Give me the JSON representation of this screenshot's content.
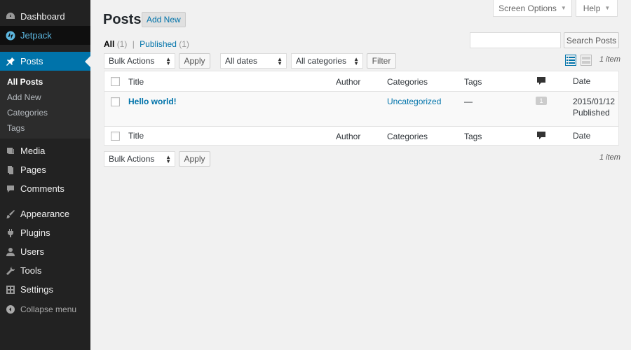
{
  "sidebar": {
    "items": [
      {
        "label": "Dashboard",
        "icon": "dashboard-icon"
      },
      {
        "label": "Jetpack",
        "icon": "jetpack-icon"
      },
      {
        "label": "Posts",
        "icon": "pushpin-icon"
      },
      {
        "label": "Media",
        "icon": "media-icon"
      },
      {
        "label": "Pages",
        "icon": "pages-icon"
      },
      {
        "label": "Comments",
        "icon": "comments-icon"
      },
      {
        "label": "Appearance",
        "icon": "paintbrush-icon"
      },
      {
        "label": "Plugins",
        "icon": "plugin-icon"
      },
      {
        "label": "Users",
        "icon": "users-icon"
      },
      {
        "label": "Tools",
        "icon": "wrench-icon"
      },
      {
        "label": "Settings",
        "icon": "settings-icon"
      }
    ],
    "submenu": [
      "All Posts",
      "Add New",
      "Categories",
      "Tags"
    ],
    "collapse": "Collapse menu"
  },
  "header": {
    "screen_options": "Screen Options",
    "help": "Help",
    "title": "Posts",
    "add_new": "Add New"
  },
  "filters": {
    "all": "All",
    "all_count": "(1)",
    "separator": "|",
    "published": "Published",
    "published_count": "(1)"
  },
  "search": {
    "button": "Search Posts",
    "value": ""
  },
  "toolbar": {
    "bulk_actions": "Bulk Actions",
    "apply": "Apply",
    "all_dates": "All dates",
    "all_categories": "All categories",
    "filter": "Filter",
    "items_count": "1 item"
  },
  "table": {
    "columns": {
      "title": "Title",
      "author": "Author",
      "categories": "Categories",
      "tags": "Tags",
      "date": "Date"
    },
    "rows": [
      {
        "title": "Hello world!",
        "author": "",
        "category": "Uncategorized",
        "tags": "—",
        "comments": "1",
        "date": "2015/01/12",
        "status": "Published"
      }
    ]
  },
  "colors": {
    "sidebar_bg": "#222222",
    "accent": "#0073aa",
    "page_bg": "#f1f1f1"
  }
}
